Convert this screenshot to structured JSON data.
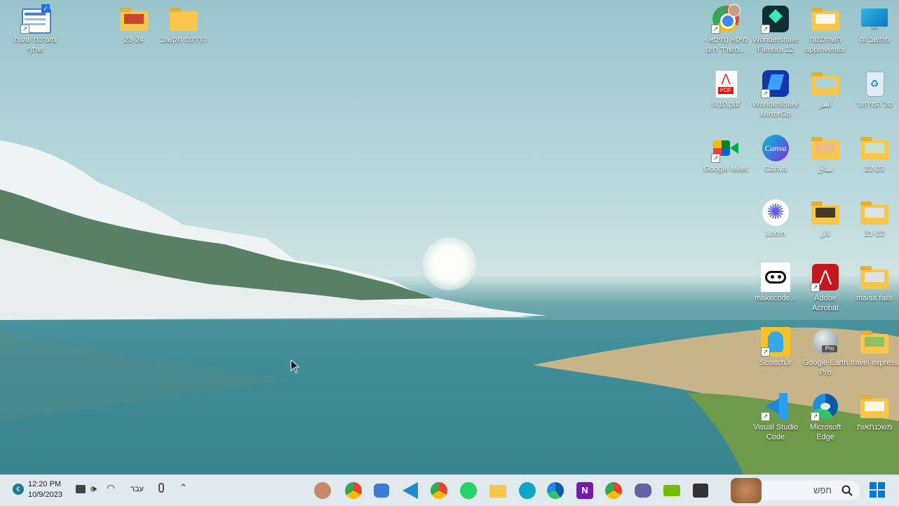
{
  "desktop_icons": [
    {
      "label": "מערכת שעות שתף"
    },
    {
      "label": "23-24"
    },
    {
      "label": "הדרכת תקשוב"
    },
    {
      "label": "מחשב זה"
    },
    {
      "label": "השתלמות appinventor"
    },
    {
      "label": "Wondershare Filmora 12"
    },
    {
      "label": "מיסא (מיסא - משרד חינו..."
    },
    {
      "label": "סל המיחזור"
    },
    {
      "label": "أسر"
    },
    {
      "label": "Wondershare MirrorGo"
    },
    {
      "label": "9.10.pdf"
    },
    {
      "label": "22-23"
    },
    {
      "label": "ساق"
    },
    {
      "label": "Canva"
    },
    {
      "label": "Google Meet"
    },
    {
      "label": "21-22"
    },
    {
      "label": "ثال"
    },
    {
      "label": "Loom"
    },
    {
      "label": "maisa fails"
    },
    {
      "label": "Adobe Acrobat"
    },
    {
      "label": "makecode..."
    },
    {
      "label": "travel express"
    },
    {
      "label": "Google Earth Pro"
    },
    {
      "label": "ScratchJr"
    },
    {
      "label": "משכנתאות"
    },
    {
      "label": "Microsoft Edge"
    },
    {
      "label": "Visual Studio Code"
    }
  ],
  "taskbar": {
    "clock_time": "12:20 PM",
    "clock_date": "10/9/2023",
    "language": "עבר",
    "search_placeholder": "חפש",
    "pinned_apps": [
      "teams-meet",
      "chrome",
      "bot",
      "vscode",
      "chrome-profile",
      "whatsapp",
      "file-explorer",
      "edge-canary",
      "edge",
      "onenote",
      "chrome-alt",
      "chat",
      "nvidia",
      "cmd",
      "search-image"
    ]
  },
  "colors": {
    "taskbar": "#dfe9ee",
    "accent": "#0078d4"
  }
}
